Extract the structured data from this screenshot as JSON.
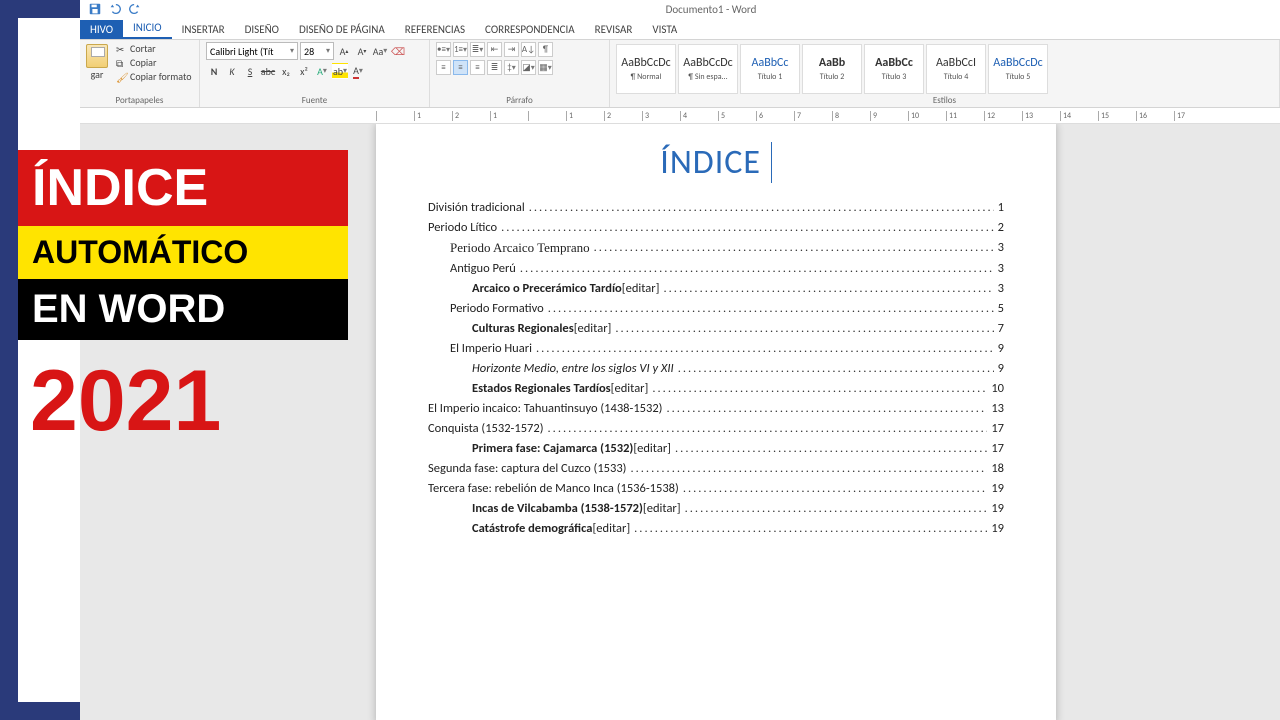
{
  "titlebar": {
    "doc": "Documento1 - Word"
  },
  "tabs": {
    "file": "HIVO",
    "inicio": "INICIO",
    "insertar": "INSERTAR",
    "diseno": "DISEÑO",
    "disenop": "DISEÑO DE PÁGINA",
    "ref": "REFERENCIAS",
    "corr": "CORRESPONDENCIA",
    "revisar": "REVISAR",
    "vista": "VISTA"
  },
  "clipboard": {
    "paste": "gar",
    "cut": "Cortar",
    "copy": "Copiar",
    "format": "Copiar formato",
    "group": "Portapapeles"
  },
  "font": {
    "name": "Calibri Light (Tít",
    "size": "28",
    "group": "Fuente",
    "bold": "N",
    "italic": "K",
    "underline": "S"
  },
  "para": {
    "group": "Párrafo"
  },
  "styles": {
    "group": "Estilos",
    "items": [
      {
        "sample": "AaBbCcDc",
        "name": "¶ Normal",
        "cls": ""
      },
      {
        "sample": "AaBbCcDc",
        "name": "¶ Sin espa...",
        "cls": ""
      },
      {
        "sample": "AaBbCc",
        "name": "Título 1",
        "cls": "t1"
      },
      {
        "sample": "AaBb",
        "name": "Título 2",
        "cls": "t2"
      },
      {
        "sample": "AaBbCc",
        "name": "Título 3",
        "cls": "t2"
      },
      {
        "sample": "AaBbCcI",
        "name": "Título 4",
        "cls": ""
      },
      {
        "sample": "AaBbCcDc",
        "name": "Título 5",
        "cls": "t1"
      }
    ]
  },
  "ruler": [
    "",
    "1",
    "2",
    "1",
    "",
    "1",
    "2",
    "3",
    "4",
    "5",
    "6",
    "7",
    "8",
    "9",
    "10",
    "11",
    "12",
    "13",
    "14",
    "15",
    "16",
    "17"
  ],
  "doc": {
    "title": "ÍNDICE",
    "toc": [
      {
        "t": "División tradicional",
        "p": "1",
        "lvl": 1
      },
      {
        "t": "Periodo Lítico",
        "p": "2",
        "lvl": 1
      },
      {
        "t": "Periodo Arcaico Temprano",
        "p": "3",
        "lvl": 2,
        "serif": true
      },
      {
        "t": "Antiguo Perú",
        "p": "3",
        "lvl": 2
      },
      {
        "t": "Arcaico o Precerámico Tardío",
        "ed": "[editar]",
        "p": "3",
        "lvl": 3,
        "bold": true
      },
      {
        "t": "Periodo Formativo",
        "p": "5",
        "lvl": 2
      },
      {
        "t": "Culturas Regionales",
        "ed": "[editar]",
        "p": "7",
        "lvl": 3,
        "bold": true
      },
      {
        "t": "El Imperio Huari",
        "p": "9",
        "lvl": 2
      },
      {
        "t": "Horizonte Medio, entre los siglos VI y XII",
        "p": "9",
        "lvl": 3,
        "italic": true
      },
      {
        "t": "Estados Regionales Tardíos",
        "ed": "[editar]",
        "p": "10",
        "lvl": 3,
        "bold": true
      },
      {
        "t": "El Imperio incaico: Tahuantinsuyo (1438-1532)",
        "p": "13",
        "lvl": 1
      },
      {
        "t": "Conquista (1532-1572)",
        "p": "17",
        "lvl": 1
      },
      {
        "t": "Primera fase: Cajamarca (1532)",
        "ed": "[editar]",
        "p": "17",
        "lvl": 3,
        "bold": true
      },
      {
        "t": "Segunda fase: captura del Cuzco (1533)",
        "p": "18",
        "lvl": 1
      },
      {
        "t": "Tercera fase: rebelión de Manco Inca (1536-1538)",
        "p": "19",
        "lvl": 1
      },
      {
        "t": "Incas de Vilcabamba (1538-1572)",
        "ed": "[editar]",
        "p": "19",
        "lvl": 3,
        "bold": true
      },
      {
        "t": "Catástrofe demográfica",
        "ed": "[editar]",
        "p": "19",
        "lvl": 3,
        "bold": true
      }
    ]
  },
  "banner": {
    "l1": "ÍNDICE",
    "l2": "AUTOMÁTICO",
    "l3": "EN WORD",
    "year": "2021"
  }
}
